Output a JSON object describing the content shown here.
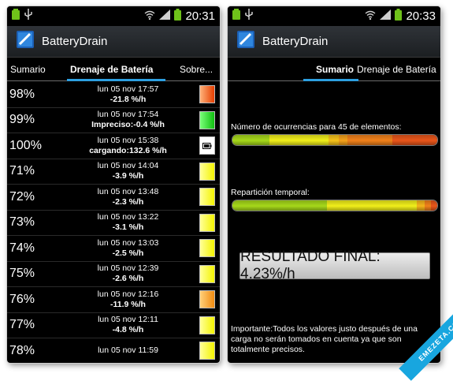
{
  "status_bar": {
    "left": {
      "time": "20:31"
    },
    "right": {
      "time": "20:33"
    }
  },
  "app": {
    "title": "BatteryDrain"
  },
  "left_screen": {
    "tabs": [
      "Sumario",
      "Drenaje de Batería",
      "Sobre..."
    ],
    "active_tab": "Drenaje de Batería",
    "rows": [
      {
        "percent": "98%",
        "date": "lun 05 nov 17:57",
        "rate": "-21.8 %/h",
        "swatch": "red"
      },
      {
        "percent": "99%",
        "date": "lun 05 nov 17:54",
        "rate": "Impreciso:-0.4 %/h",
        "swatch": "green"
      },
      {
        "percent": "100%",
        "date": "lun 05 nov 15:38",
        "rate": "cargando:132.6 %/h",
        "swatch": "charging"
      },
      {
        "percent": "71%",
        "date": "lun 05 nov 14:04",
        "rate": "-3.9 %/h",
        "swatch": "yellow"
      },
      {
        "percent": "72%",
        "date": "lun 05 nov 13:48",
        "rate": "-2.3 %/h",
        "swatch": "yellow"
      },
      {
        "percent": "73%",
        "date": "lun 05 nov 13:22",
        "rate": "-3.1 %/h",
        "swatch": "yellow"
      },
      {
        "percent": "74%",
        "date": "lun 05 nov 13:03",
        "rate": "-2.5 %/h",
        "swatch": "yellow"
      },
      {
        "percent": "75%",
        "date": "lun 05 nov 12:39",
        "rate": "-2.6 %/h",
        "swatch": "yellow"
      },
      {
        "percent": "76%",
        "date": "lun 05 nov 12:16",
        "rate": "-11.9 %/h",
        "swatch": "orange"
      },
      {
        "percent": "77%",
        "date": "lun 05 nov 12:11",
        "rate": "-4.8 %/h",
        "swatch": "yellow"
      },
      {
        "percent": "78%",
        "date": "lun 05 nov 11:59",
        "rate": "",
        "swatch": "yellow"
      }
    ]
  },
  "right_screen": {
    "tabs": [
      "Sumario",
      "Drenaje de Batería"
    ],
    "active_tab": "Sumario",
    "occurrences_label": "Número de ocurrencias para 45 de elementos:",
    "temporal_label": "Repartición temporal:",
    "result": "RESULTADO FINAL: 4.23%/h",
    "note": "Importante:Todos los valores justo después de una carga no serán tomados en cuenta ya que son totalmente precisos.",
    "occurrences_bar": [
      {
        "color": "#a6d81a",
        "share": 0.18
      },
      {
        "color": "#f1ef1a",
        "share": 0.29
      },
      {
        "color": "#f6c21a",
        "share": 0.05
      },
      {
        "color": "#f5a11a",
        "share": 0.04
      },
      {
        "color": "#f1811a",
        "share": 0.22
      },
      {
        "color": "#e9561a",
        "share": 0.22
      }
    ],
    "temporal_bar": [
      {
        "color": "#a6d81a",
        "share": 0.46
      },
      {
        "color": "#f1ef1a",
        "share": 0.44
      },
      {
        "color": "#f5b41a",
        "share": 0.04
      },
      {
        "color": "#f1811a",
        "share": 0.03
      },
      {
        "color": "#e9561a",
        "share": 0.03
      }
    ]
  },
  "watermark": "EMEZETA.COM",
  "colors": {
    "tab_indicator": "#2d9fe0",
    "watermark_bg": "#18a6df"
  }
}
